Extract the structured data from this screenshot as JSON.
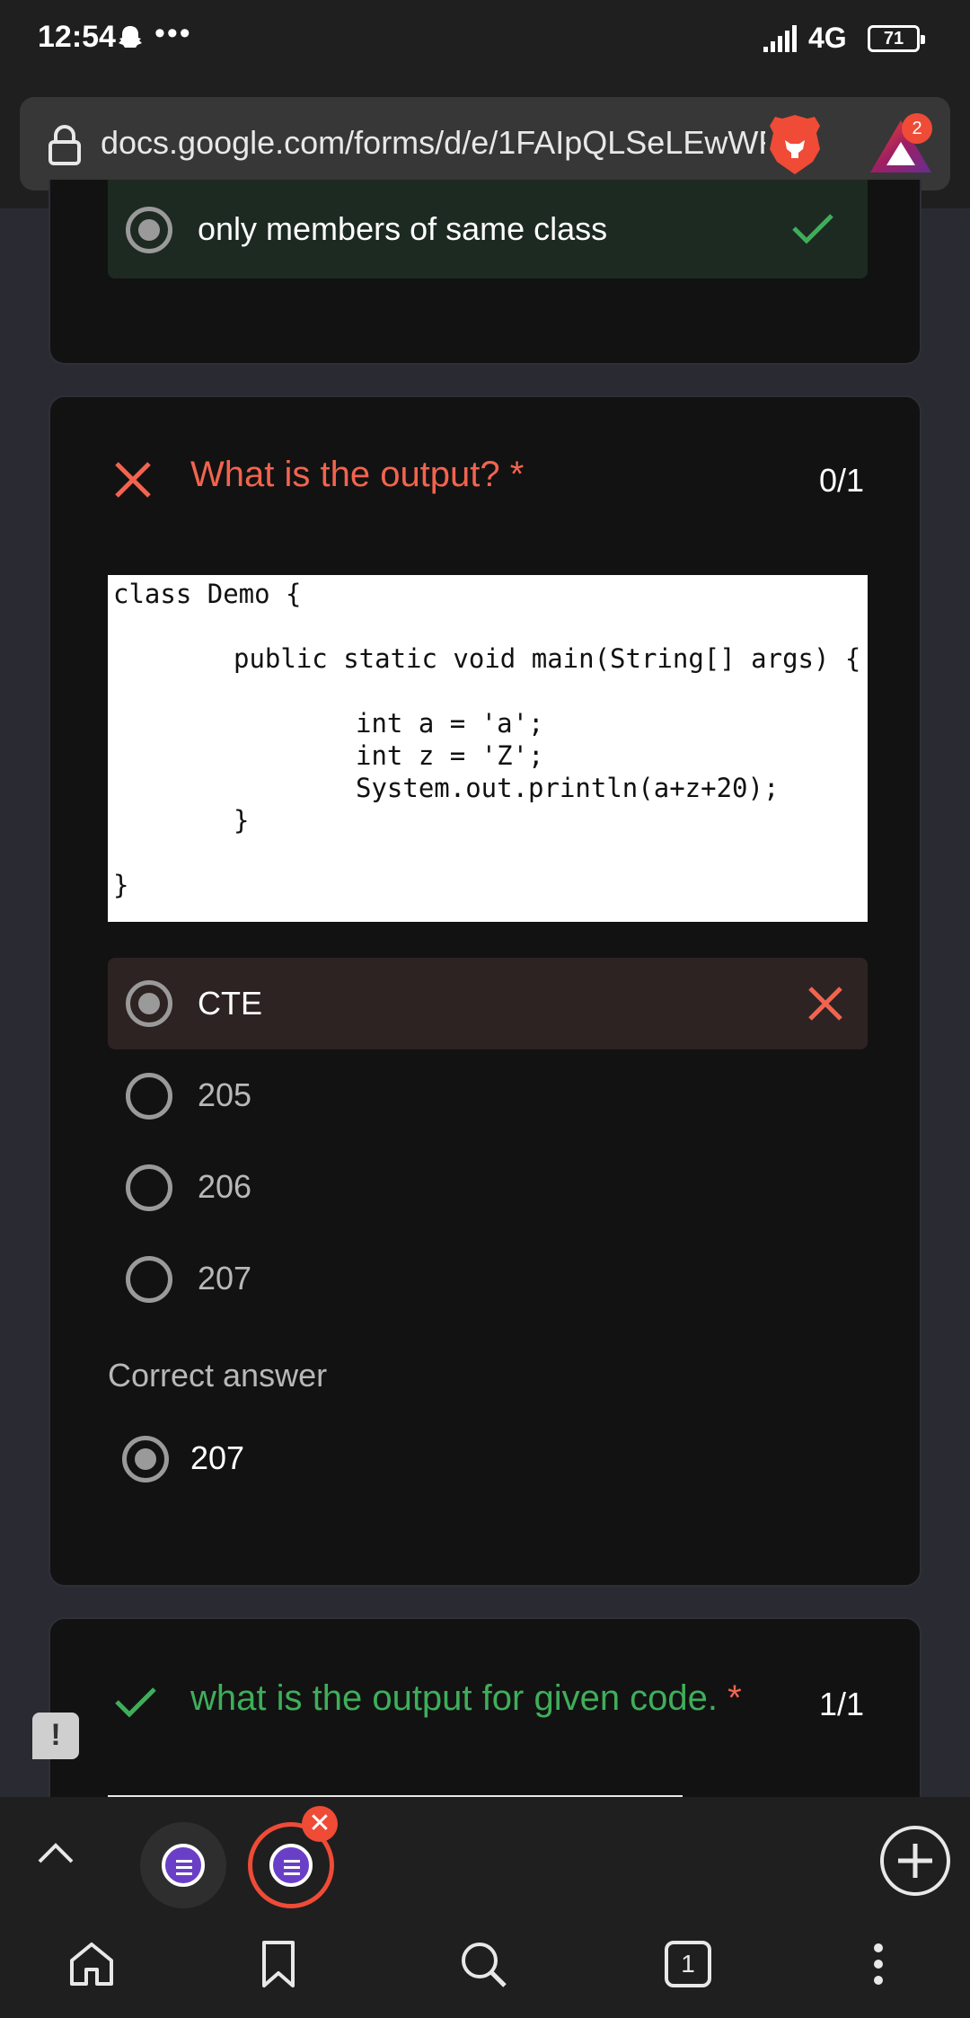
{
  "status_bar": {
    "time": "12:54",
    "dots": "•••",
    "network": "4G",
    "battery": "71"
  },
  "browser": {
    "url": "docs.google.com/forms/d/e/1FAIpQLSeLEwWR4",
    "rewards_badge": "2"
  },
  "question1": {
    "selected_option": "only members of same class",
    "status": "correct"
  },
  "question2": {
    "title": "What is the output? *",
    "score": "0/1",
    "status": "wrong",
    "code_lines": [
      "class Demo {",
      "public static void main(String[] args) {",
      "int a = 'a';",
      "int z = 'Z';",
      "System.out.println(a+z+20);",
      "}",
      "}"
    ],
    "options": [
      {
        "label": "CTE",
        "selected": true,
        "result": "wrong"
      },
      {
        "label": "205",
        "selected": false
      },
      {
        "label": "206",
        "selected": false
      },
      {
        "label": "207",
        "selected": false
      }
    ],
    "correct_answer_title": "Correct answer",
    "correct_answer": "207"
  },
  "question3": {
    "title": "what is the output for given code.",
    "required_mark": "*",
    "score": "1/1",
    "status": "correct"
  },
  "feedback_icon": "!",
  "tab_strip": {
    "tab_count_label": "1",
    "close_glyph": "✕"
  },
  "colors": {
    "correct_green": "#3fae5a",
    "wrong_red": "#f2644f",
    "brave_orange": "#ef4b36",
    "forms_purple": "#6a3fc8"
  }
}
